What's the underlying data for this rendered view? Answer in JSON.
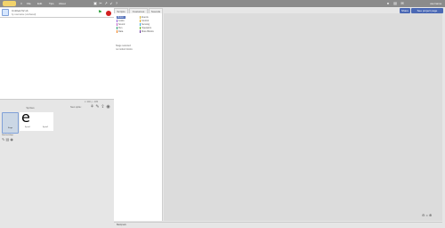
{
  "menubar": {
    "icons": [
      "globe-icon",
      "folder-icon",
      "edit-icon",
      "tips-icon",
      "help-icon"
    ],
    "items": [
      "File",
      "Edit",
      "Tips",
      "About"
    ],
    "right_icons": [
      "account-icon",
      "folder-icon",
      "speech-icon",
      "settings-icon"
    ],
    "user_label": "username"
  },
  "stage": {
    "title_value": "Untitled-52 sb",
    "owner_text": "by username (unshared)",
    "xy_readout": "x: 240 y: -180",
    "flag_icon": "green-flag-icon",
    "stop_icon": "stop-icon"
  },
  "sprites": {
    "label": "Sprites",
    "new_sprite_label": "New sprite:",
    "items": [
      {
        "name": "Sprite1",
        "glyph": "e"
      },
      {
        "name": "Sprite2"
      }
    ],
    "stage_label": "Stage",
    "stage_sub": "1 backdrop",
    "backdrop_label": "New backdrop:",
    "backdrop_icons": [
      "paint-icon",
      "folder-icon",
      "camera-icon"
    ]
  },
  "tabs": [
    "Scripts",
    "Costumes",
    "Sounds"
  ],
  "categories_left": [
    "Motion",
    "Looks",
    "Sound",
    "Pen",
    "Data"
  ],
  "categories_right": [
    "Events",
    "Control",
    "Sensing",
    "Operators",
    "More Blocks"
  ],
  "category_colors": [
    "#4b69b5",
    "#8f5cd6",
    "#bb5cc8",
    "#249c6c",
    "#ee7d16",
    "#d8b22e",
    "#e1a91a",
    "#2ca5e2",
    "#5cb712",
    "#632d99"
  ],
  "blocks": [
    "Stage selected:",
    "no motion blocks"
  ],
  "topbar": {
    "share_label": "Share",
    "see_project_label": "See project page"
  },
  "workspace": {
    "zoom_icons": [
      "zoom-out-icon",
      "zoom-reset-icon",
      "zoom-in-icon"
    ]
  },
  "backpack_label": "Backpack"
}
